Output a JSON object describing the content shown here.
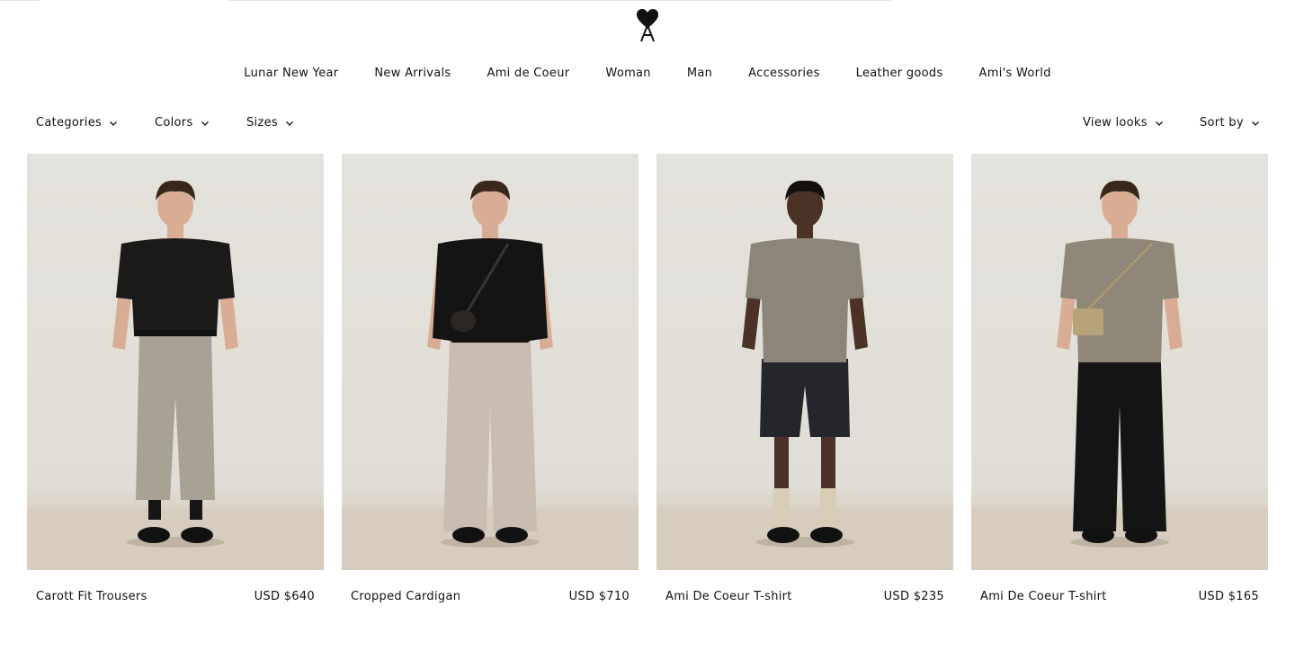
{
  "brand": {
    "logo_icon": "ami-heart-a-logo-icon"
  },
  "nav": {
    "items": [
      {
        "label": "Lunar New Year"
      },
      {
        "label": "New Arrivals"
      },
      {
        "label": "Ami de Coeur"
      },
      {
        "label": "Woman"
      },
      {
        "label": "Man"
      },
      {
        "label": "Accessories"
      },
      {
        "label": "Leather goods"
      },
      {
        "label": "Ami's World"
      }
    ]
  },
  "filters": {
    "categories": "Categories",
    "colors": "Colors",
    "sizes": "Sizes",
    "view_looks": "View looks",
    "sort_by": "Sort by",
    "chevron_icon": "chevron-down-icon"
  },
  "products": [
    {
      "name": "Carott Fit Trousers",
      "price": "USD $640",
      "top_color": "#1c1a19",
      "bottom_color": "#a7a294"
    },
    {
      "name": "Cropped Cardigan",
      "price": "USD $710",
      "top_color": "#151414",
      "bottom_color": "#c9bdb1"
    },
    {
      "name": "Ami De Coeur T-shirt",
      "price": "USD $235",
      "top_color": "#8c857a",
      "bottom_color": "#25262b"
    },
    {
      "name": "Ami De Coeur T-shirt",
      "price": "USD $165",
      "top_color": "#8f8878",
      "bottom_color": "#141414"
    }
  ],
  "colors": {
    "background": "#ffffff",
    "text": "#111111",
    "photo_backdrop": "#e2dfd8",
    "photo_floor": "#d4cbbd"
  }
}
